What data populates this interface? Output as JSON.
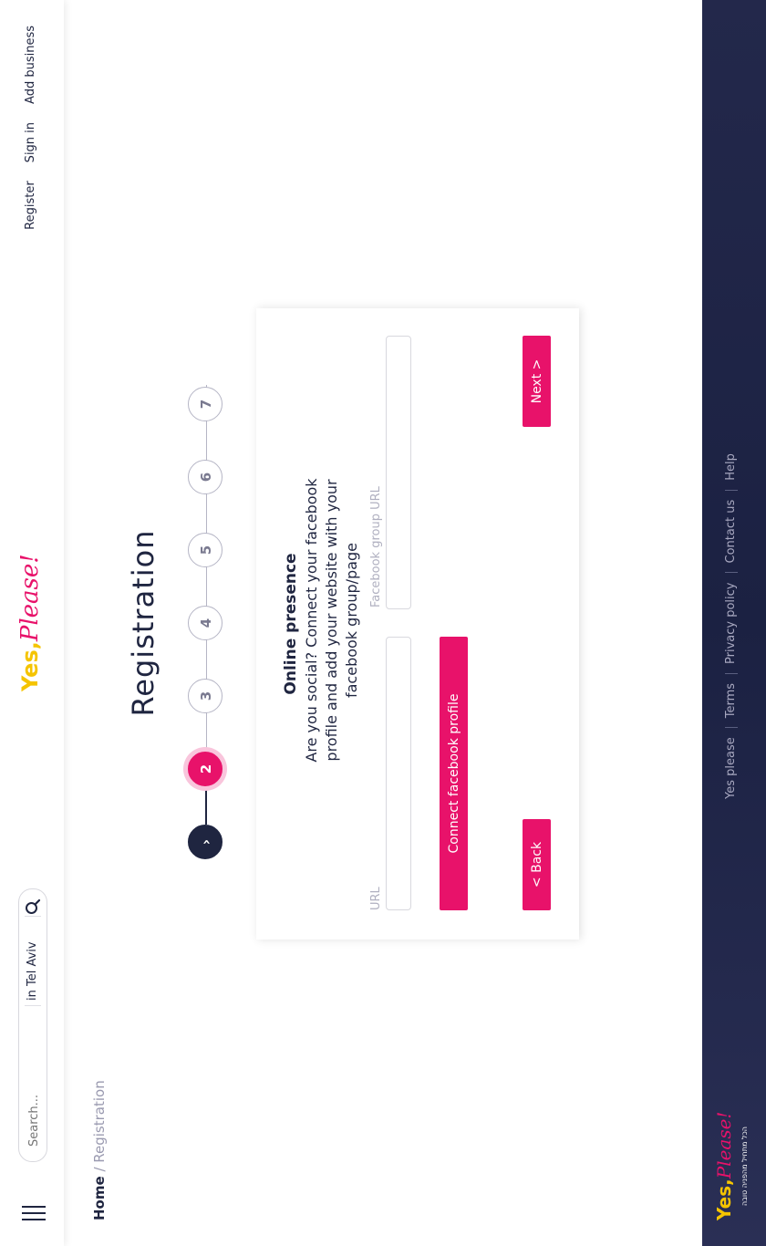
{
  "header": {
    "search_placeholder": "Search...",
    "location": "in Tel Aviv",
    "logo_yes": "Yes,",
    "logo_please": "Please!",
    "nav": [
      "Register",
      "Sign in",
      "Add business"
    ]
  },
  "breadcrumb": {
    "home": "Home",
    "sep": " / ",
    "current": "Registration"
  },
  "page_title": "Registration",
  "stepper": {
    "completed_symbol": "›",
    "steps": [
      "2",
      "3",
      "4",
      "5",
      "6",
      "7"
    ],
    "current_step": 2
  },
  "card": {
    "title": "Online presence",
    "description": "Are you social? Connect your facebook profile and add your website with your facebook group/page",
    "url_label": "URL",
    "fb_group_label": "Facebook group URL",
    "connect_button": "Connect facebook profile",
    "back_button": "< Back",
    "next_button": "Next >"
  },
  "footer": {
    "logo_yes": "Yes,",
    "logo_please": "Please!",
    "tagline": "הכל מתחיל מהפניה טובה",
    "links": [
      "Yes please",
      "Terms",
      "Privacy policy",
      "Contact us",
      "Help"
    ]
  },
  "colors": {
    "accent": "#e8126a",
    "brand_yellow": "#f5c400",
    "navy": "#1f2540"
  }
}
